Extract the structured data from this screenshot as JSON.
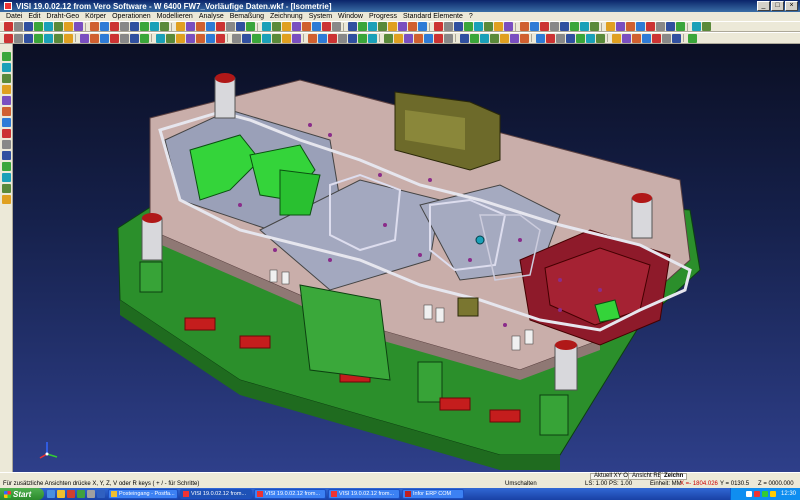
{
  "window": {
    "title": "VISI 19.0.02.12 from Vero Software - W 6400 FW7_Vorläufige Daten.wkf - [Isometrie]",
    "controls": [
      "_",
      "□",
      "×"
    ]
  },
  "menu": {
    "items": [
      "Datei",
      "Edit",
      "Draht-Geo",
      "Körper",
      "Operationen",
      "Modellieren",
      "Analyse",
      "Bemaßung",
      "Zeichnung",
      "System",
      "Window",
      "Progress",
      "Standard Elemente",
      "?"
    ]
  },
  "viewport": {
    "view_name": "Isometrie",
    "label_small": "Z|X|Y",
    "triad_labels": [
      "X",
      "Y",
      "Z"
    ]
  },
  "status": {
    "hint": "Für zusätzliche Ansichten drücke X, Y, Z, V oder R keys ( + / - für Schritte)",
    "tab_current": "Aktuell XY Obe",
    "tab_view": "Ansicht REL",
    "tab_draw": "Zeichn",
    "umschalten": "Umschalten",
    "ls": "LS: 1.00 PS: 1.00",
    "units": "Einheit: MM",
    "coord_x": "X =- 1804.026",
    "coord_y": "Y = 0130.5",
    "coord_z": "Z = 0000.000"
  },
  "taskbar": {
    "start_label": "Start",
    "tasks": [
      {
        "label": "Posteingang - Postfa...",
        "active": false
      },
      {
        "label": "VISI 19.0.02.12 from...",
        "active": true
      },
      {
        "label": "VISI 19.0.02.12 from...",
        "active": false
      },
      {
        "label": "VISI 19.0.02.12 from...",
        "active": false
      },
      {
        "label": "Infor ERP COM",
        "active": false
      }
    ],
    "clock": "12:30"
  }
}
